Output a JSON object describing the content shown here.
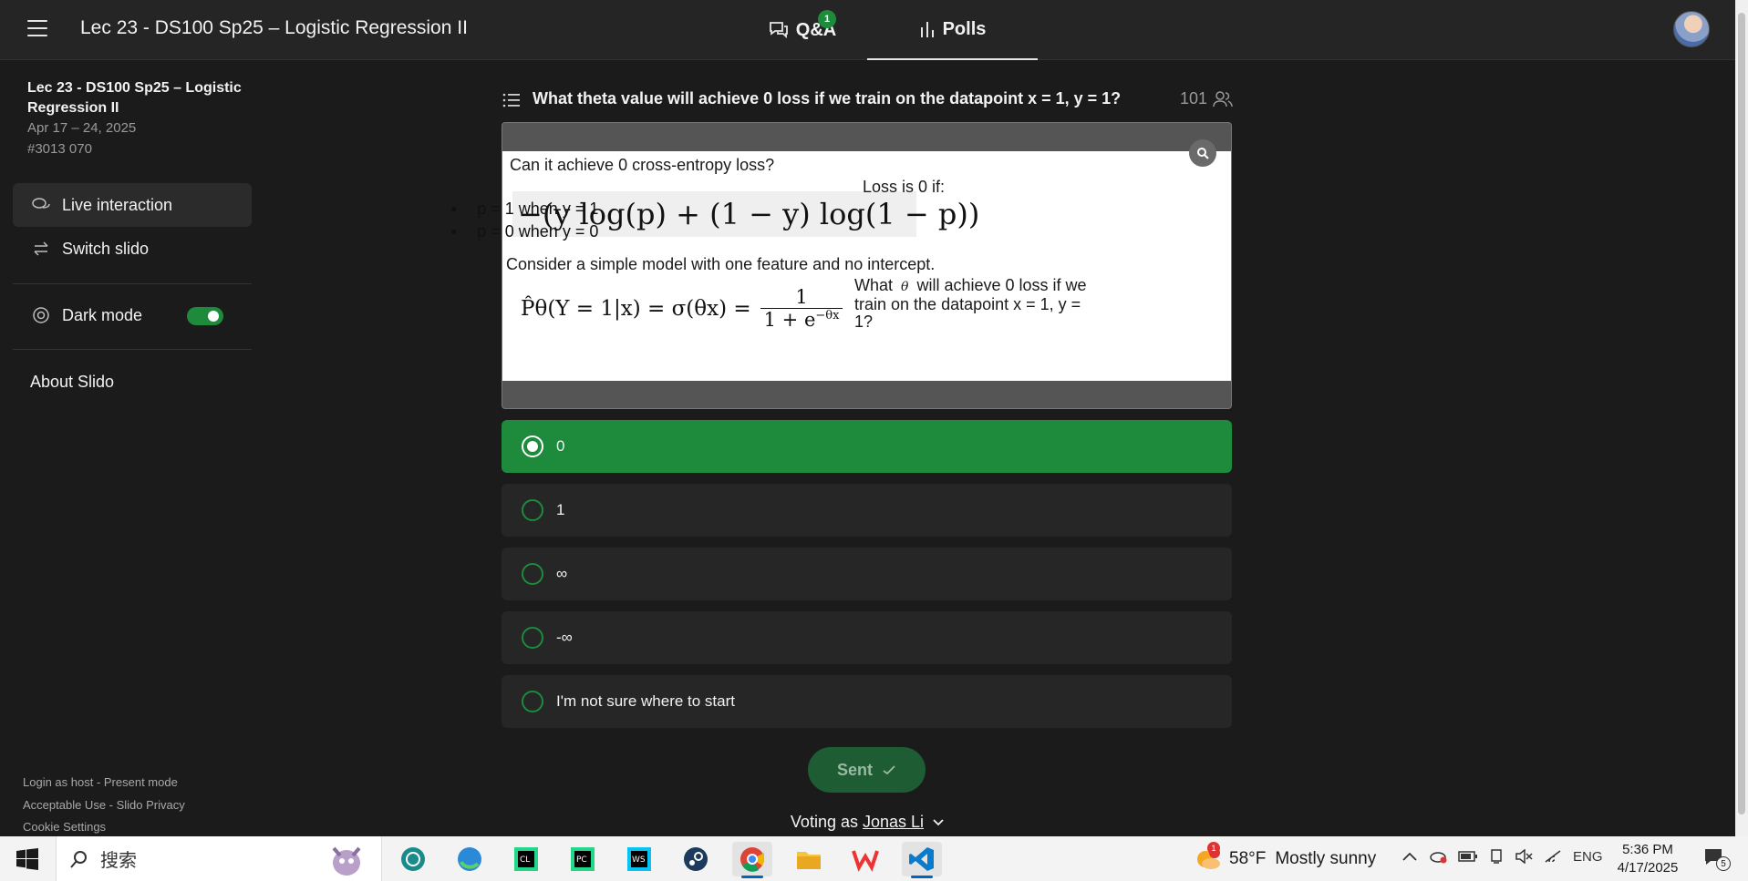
{
  "header": {
    "title": "Lec 23 - DS100 Sp25 – Logistic Regression II",
    "tabs": [
      {
        "label": "Q&A",
        "badge": "1"
      },
      {
        "label": "Polls",
        "active": true
      }
    ]
  },
  "sidebar": {
    "event_name": "Lec 23 - DS100 Sp25 – Logistic Regression II",
    "event_date": "Apr 17 – 24, 2025",
    "event_code": "#3013 070",
    "items": [
      {
        "label": "Live interaction",
        "icon": "chat-bubbles-icon"
      },
      {
        "label": "Switch slido",
        "icon": "switch-arrows-icon"
      },
      {
        "label": "Dark mode",
        "icon": "brightness-icon",
        "toggle_on": true
      }
    ],
    "about": "About Slido",
    "footer": {
      "line1": "Login as host - Present mode",
      "line2": "Acceptable Use - Slido Privacy",
      "line3": "Cookie Settings"
    }
  },
  "poll": {
    "question": "What theta value will achieve 0 loss if we train on the datapoint x = 1, y = 1?",
    "voter_count": "101",
    "slide": {
      "heading1": "Can it achieve 0 cross-entropy loss?",
      "formula1": "−(y log(p) + (1 − y) log(1 − p))",
      "loss_title": "Loss is 0 if:",
      "bullet1": "p = 1 when y = 1",
      "bullet2": "p = 0 when y = 0",
      "heading2": "Consider a simple model with one feature and no intercept.",
      "formula2_lhs": "P̂θ(Y = 1|x) = σ(θx) =",
      "formula2_num": "1",
      "formula2_den": "1 + e",
      "formula2_exp": "−θx",
      "side_q_pre": "What",
      "side_q_theta": "θ",
      "side_q_post": "will achieve 0 loss if we train on the datapoint x = 1, y = 1?"
    },
    "options": [
      {
        "label": "0",
        "selected": true
      },
      {
        "label": "1",
        "selected": false
      },
      {
        "label": "∞",
        "selected": false
      },
      {
        "label": "-∞",
        "selected": false
      },
      {
        "label": "I'm not sure where to start",
        "selected": false
      }
    ],
    "sent_label": "Sent",
    "voting_prefix": "Voting as",
    "voter_name": "Jonas Li"
  },
  "colors": {
    "accent_green": "#1d8a3c",
    "background": "#1b1b1b",
    "panel": "#262626"
  },
  "taskbar": {
    "search_placeholder": "搜索",
    "apps": [
      "widgets-icon",
      "qiwen-icon",
      "edge-icon",
      "clion-icon",
      "pycharm-icon",
      "webstorm-icon",
      "steam-icon",
      "chrome-icon",
      "file-explorer-icon",
      "wps-icon",
      "vscode-icon"
    ],
    "weather_temp": "58°F",
    "weather_desc": "Mostly sunny",
    "weather_badge": "1",
    "lang": "ENG",
    "time": "5:36 PM",
    "date": "4/17/2025",
    "notif_count": "5"
  }
}
